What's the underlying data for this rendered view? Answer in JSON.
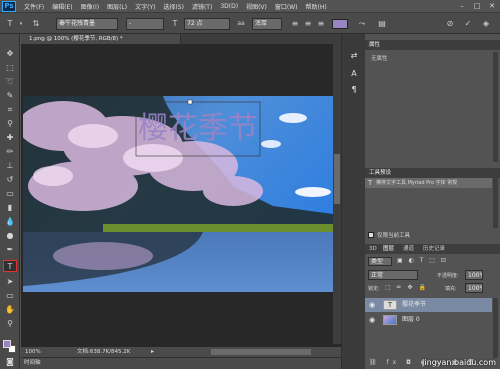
{
  "app": {
    "logo": "Ps"
  },
  "menu": [
    "文件(F)",
    "编辑(E)",
    "图像(I)",
    "图层(L)",
    "文字(Y)",
    "选择(S)",
    "滤镜(T)",
    "3D(D)",
    "视图(V)",
    "窗口(W)",
    "帮助(H)"
  ],
  "window_controls": [
    "–",
    "□",
    "✕"
  ],
  "options_bar": {
    "font_family": "秦牛花残青墨",
    "font_style": "-",
    "font_size": "72 点",
    "antialias": "浑厚",
    "text_color": "#9a84c4"
  },
  "document": {
    "tab_title": "1.png @ 100% (樱花季节, RGB/8) *",
    "canvas_text": "樱花季节",
    "zoom": "100%",
    "doc_size": "文档:638.7K/845.2K",
    "timeline_label": "时间轴"
  },
  "panels": {
    "properties": {
      "title": "属性",
      "body": "无属性"
    },
    "tool_presets": {
      "title": "工具预设",
      "item": "横排文字工具 Myriad Pro 字体 常规",
      "current_tool_only": "仅限当前工具"
    },
    "layers": {
      "tabs": [
        "3D",
        "图层",
        "通道",
        "历史记录"
      ],
      "kind_label": "类型",
      "blend_mode": "正常",
      "opacity_label": "不透明度:",
      "opacity": "100%",
      "lock_label": "锁定:",
      "fill_label": "填充:",
      "fill": "100%",
      "items": [
        {
          "name": "樱花季节",
          "type": "text"
        },
        {
          "name": "图层 0",
          "type": "image"
        }
      ]
    }
  },
  "watermark": "jingyan.baidu.com",
  "colors": {
    "foreground": "#9a84c4",
    "background": "#ffffff",
    "accent_selection": "#e03030"
  }
}
